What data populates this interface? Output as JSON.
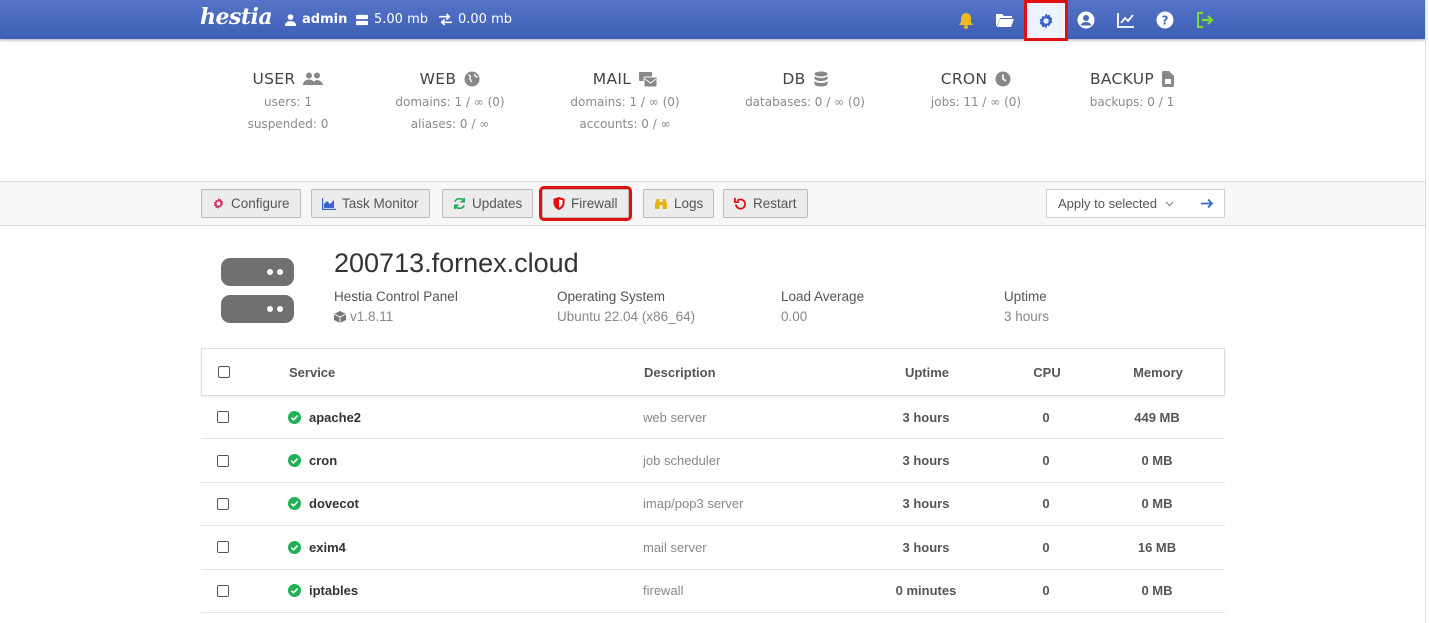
{
  "topbar": {
    "logo": "hestia",
    "user": "admin",
    "disk": "5.00 mb",
    "bandwidth": "0.00 mb"
  },
  "stats": [
    {
      "title": "USER",
      "icon": "users-icon",
      "lines": [
        "users: 1",
        "suspended: 0"
      ]
    },
    {
      "title": "WEB",
      "icon": "globe-icon",
      "lines": [
        "domains: 1 / ∞ (0)",
        "aliases: 0 / ∞"
      ]
    },
    {
      "title": "MAIL",
      "icon": "mail-icon",
      "lines": [
        "domains: 1 / ∞ (0)",
        "accounts: 0 / ∞"
      ]
    },
    {
      "title": "DB",
      "icon": "database-icon",
      "lines": [
        "databases: 0 / ∞ (0)"
      ]
    },
    {
      "title": "CRON",
      "icon": "clock-icon",
      "lines": [
        "jobs: 11 / ∞ (0)"
      ]
    },
    {
      "title": "BACKUP",
      "icon": "file-icon",
      "lines": [
        "backups: 0 / 1"
      ]
    }
  ],
  "toolbar": {
    "configure": "Configure",
    "task_monitor": "Task Monitor",
    "updates": "Updates",
    "firewall": "Firewall",
    "logs": "Logs",
    "restart": "Restart",
    "apply_selected": "Apply to selected"
  },
  "server": {
    "hostname": "200713.fornex.cloud",
    "panel_label": "Hestia Control Panel",
    "panel_version": "v1.8.11",
    "os_label": "Operating System",
    "os_value": "Ubuntu 22.04 (x86_64)",
    "load_label": "Load Average",
    "load_value": "0.00",
    "uptime_label": "Uptime",
    "uptime_value": "3 hours"
  },
  "table": {
    "headers": {
      "service": "Service",
      "description": "Description",
      "uptime": "Uptime",
      "cpu": "CPU",
      "memory": "Memory"
    },
    "rows": [
      {
        "service": "apache2",
        "description": "web server",
        "uptime": "3 hours",
        "cpu": "0",
        "memory": "449 MB"
      },
      {
        "service": "cron",
        "description": "job scheduler",
        "uptime": "3 hours",
        "cpu": "0",
        "memory": "0 MB"
      },
      {
        "service": "dovecot",
        "description": "imap/pop3 server",
        "uptime": "3 hours",
        "cpu": "0",
        "memory": "0 MB"
      },
      {
        "service": "exim4",
        "description": "mail server",
        "uptime": "3 hours",
        "cpu": "0",
        "memory": "16 MB"
      },
      {
        "service": "iptables",
        "description": "firewall",
        "uptime": "0 minutes",
        "cpu": "0",
        "memory": "0 MB"
      }
    ]
  },
  "colors": {
    "topbar": "#4a6abe",
    "highlight": "#e01010",
    "status_ok": "#1fb154"
  }
}
